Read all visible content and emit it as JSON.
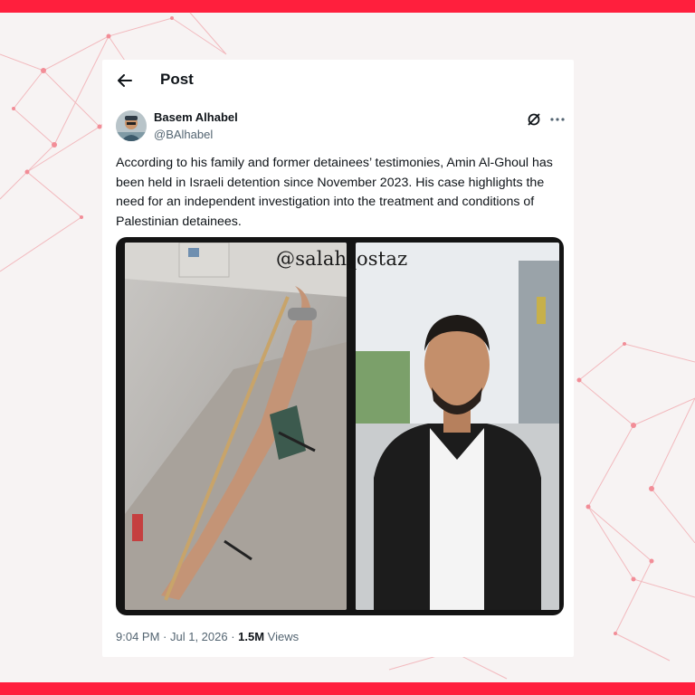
{
  "header": {
    "title": "Post"
  },
  "author": {
    "name": "Basem Alhabel",
    "handle": "@BAlhabel"
  },
  "tweet": {
    "text": "According to his family and former detainees’ testimonies, Amin Al-Ghoul has been held in Israeli detention since November 2023. His case highlights the need for an independent investigation into the treatment and conditions of Palestinian detainees."
  },
  "media": {
    "watermark": "@salah_ostaz"
  },
  "meta": {
    "time": "9:04 PM",
    "sep1": " · ",
    "date": "Jul 1, 2026",
    "sep2": " · ",
    "views_count": "1.5M",
    "views_label": " Views"
  },
  "icons": {
    "back": "arrow-left-icon",
    "grok": "grok-icon",
    "more": "more-horizontal-icon"
  },
  "colors": {
    "brand_bar": "#ff1f3d",
    "text": "#0f1419",
    "secondary": "#536471"
  }
}
